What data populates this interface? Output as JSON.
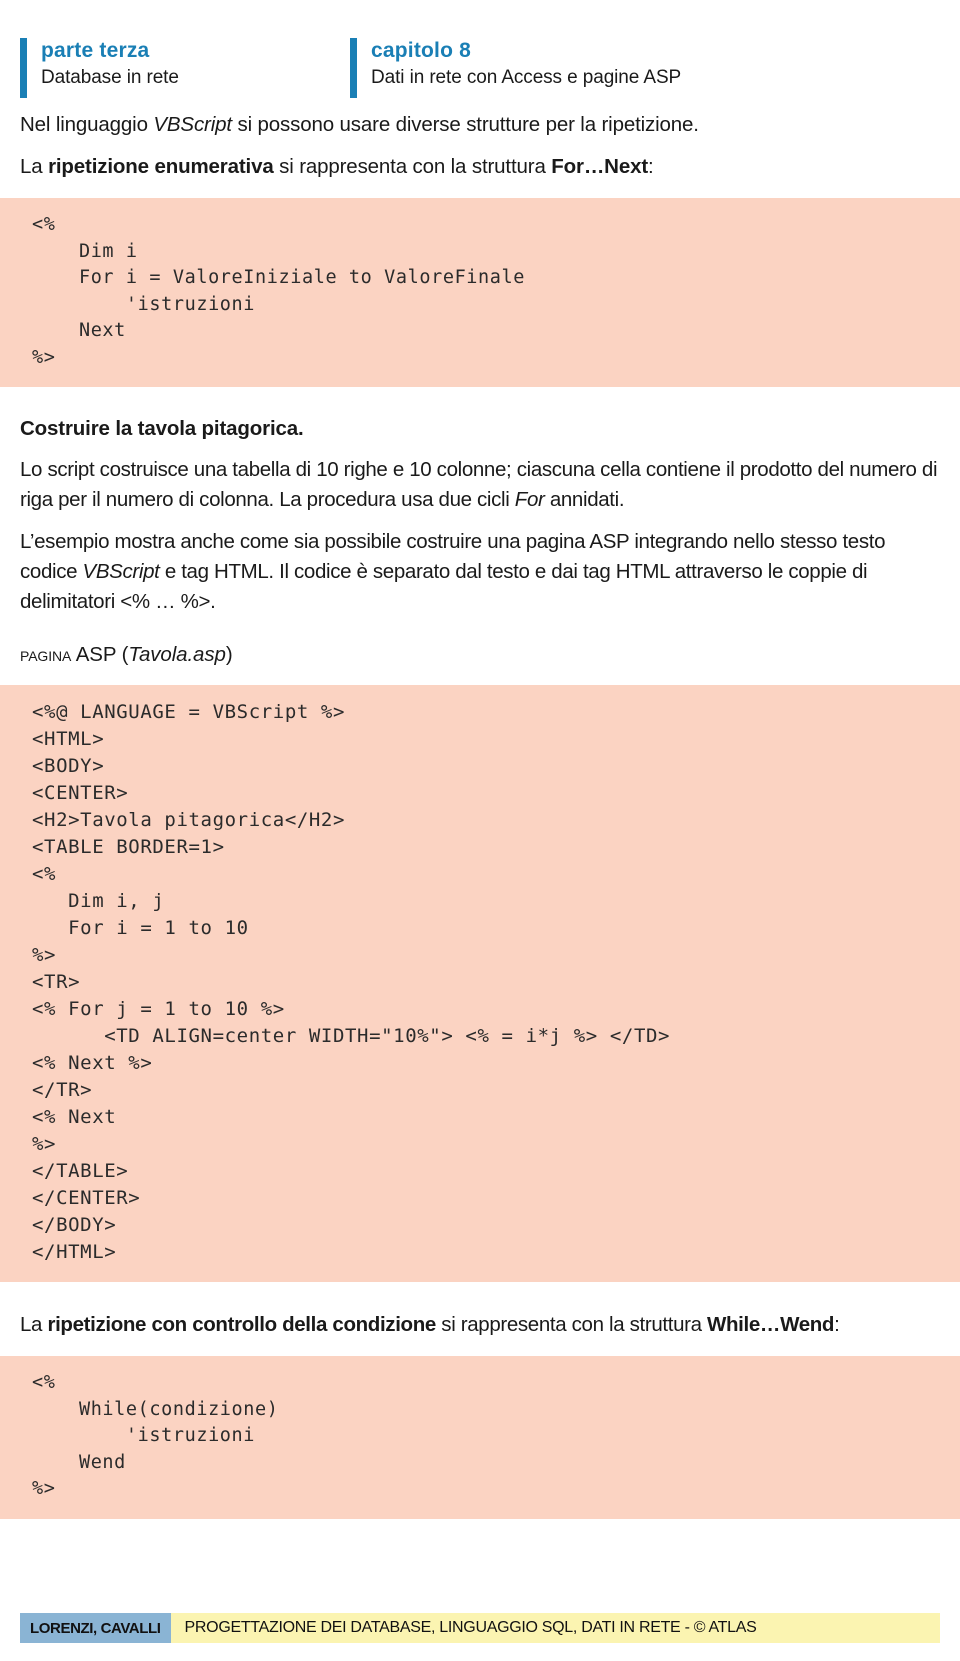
{
  "header": {
    "left": {
      "kicker": "parte terza",
      "subtitle": "Database in rete"
    },
    "right": {
      "kicker": "capitolo 8",
      "subtitle": "Dati in rete con Access e pagine ASP"
    },
    "accent_color": "#1a7fb5"
  },
  "intro": {
    "line1_a": "Nel linguaggio ",
    "line1_italic": "VBScript",
    "line1_b": " si possono usare diverse strutture per la ripetizione.",
    "line2_a": "La ",
    "line2_bold": "ripetizione enumerativa",
    "line2_b": " si rappresenta con la struttura ",
    "line2_bold2": "For…Next",
    "line2_c": ":"
  },
  "code_for_next": "<%\n    Dim i\n    For i = ValoreIniziale to ValoreFinale\n        'istruzioni\n    Next\n%>",
  "section": {
    "heading": "Costruire la tavola pitagorica.",
    "p1_a": "Lo script costruisce una tabella di 10 righe e 10 colonne; ciascuna cella contiene il prodotto del numero di riga per il numero di colonna. La procedura usa due cicli ",
    "p1_italic": "For",
    "p1_b": " annidati.",
    "p2_a": "L’esempio mostra anche come sia possibile costruire una pagina ASP integrando nello stesso testo codice ",
    "p2_italic": "VBScript",
    "p2_b": " e tag HTML. Il codice è separato dal testo e dai tag HTML attraverso le coppie di delimitatori <% … %>."
  },
  "asp_label": {
    "smallcaps": "Pagina",
    "rest": " ASP (",
    "italic": "Tavola.asp",
    "close": ")"
  },
  "code_asp": "<%@ LANGUAGE = VBScript %>\n<HTML>\n<BODY>\n<CENTER>\n<H2>Tavola pitagorica</H2>\n<TABLE BORDER=1>\n<%\n   Dim i, j\n   For i = 1 to 10\n%>\n<TR>\n<% For j = 1 to 10 %>\n      <TD ALIGN=center WIDTH=\"10%\"> <% = i*j %> </TD>\n<% Next %>\n</TR>\n<% Next\n%>\n</TABLE>\n</CENTER>\n</BODY>\n</HTML>",
  "while_para": {
    "a": "La ",
    "bold": "ripetizione con controllo della condizione",
    "b": " si rappresenta con la struttura ",
    "bold2": "While…Wend",
    "c": ":"
  },
  "code_while_wend": "<%\n    While(condizione)\n        'istruzioni\n    Wend\n%>",
  "footer": {
    "authors": "LORENZI, CAVALLI",
    "title": "PROGETTAZIONE DEI DATABASE, LINGUAGGIO SQL, DATI IN RETE - © ATLAS",
    "authors_bg": "#8ab4d4",
    "title_bg": "#fbf4b1"
  },
  "colors": {
    "code_bg": "#fbd3c2",
    "accent_blue": "#1a7fb5"
  }
}
